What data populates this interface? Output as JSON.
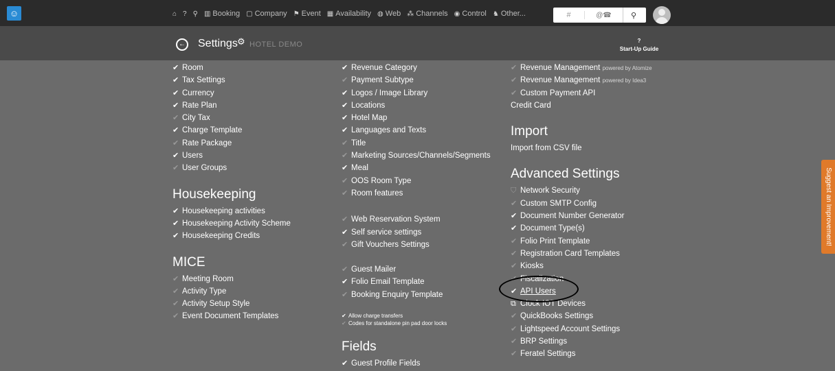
{
  "nav": {
    "home": "",
    "help": "",
    "search": "",
    "booking": "Booking",
    "company": "Company",
    "event": "Event",
    "availability": "Availability",
    "web": "Web",
    "channels": "Channels",
    "control": "Control",
    "other": "Other..."
  },
  "search": {
    "placeholder": "#",
    "mid": "@☎"
  },
  "subbar": {
    "title": "Settings",
    "hotel": "HOTEL DEMO",
    "guide_q": "?",
    "guide_label": "Start-Up Guide"
  },
  "col1": {
    "items": [
      "Room",
      "Tax Settings",
      "Currency",
      "Rate Plan",
      "City Tax",
      "Charge Template",
      "Rate Package",
      "Users",
      "User Groups"
    ],
    "housekeeping_head": "Housekeeping",
    "housekeeping": [
      "Housekeeping activities",
      "Housekeeping Activity Scheme",
      "Housekeeping Credits"
    ],
    "mice_head": "MICE",
    "mice": [
      "Meeting Room",
      "Activity Type",
      "Activity Setup Style",
      "Event Document Templates"
    ]
  },
  "col2": {
    "items": [
      "Revenue Category",
      "Payment Subtype",
      "Logos / Image Library",
      "Locations",
      "Hotel Map",
      "Languages and Texts",
      "Title",
      "Marketing Sources/Channels/Segments",
      "Meal",
      "OOS Room Type",
      "Room features"
    ],
    "web": [
      "Web Reservation System",
      "Self service settings",
      "Gift Vouchers Settings"
    ],
    "mail": [
      "Guest Mailer",
      "Folio Email Template",
      "Booking Enquiry Template"
    ],
    "small": [
      "Allow charge transfers",
      "Codes for standalone pin pad door locks"
    ],
    "fields_head": "Fields",
    "fields": [
      "Guest Profile Fields"
    ]
  },
  "col3": {
    "rev1": "Revenue Management",
    "rev1_sub": "powered by Atomize",
    "rev2": "Revenue Management",
    "rev2_sub": "powered by Idea3",
    "custom_payment": "Custom Payment API",
    "credit_card": "Credit Card",
    "import_head": "Import",
    "import_item": "Import from CSV file",
    "adv_head": "Advanced Settings",
    "network": "Network Security",
    "adv": [
      "Custom SMTP Config",
      "Document Number Generator",
      "Document Type(s)",
      "Folio Print Template",
      "Registration Card Templates",
      "Kiosks",
      "Fiscalization",
      "API Users"
    ],
    "clock": "Clock IOT Devices",
    "adv2": [
      "QuickBooks Settings",
      "Lightspeed Account Settings",
      "BRP Settings",
      "Feratel Settings"
    ]
  },
  "suggest": "Suggest an Improvement!"
}
